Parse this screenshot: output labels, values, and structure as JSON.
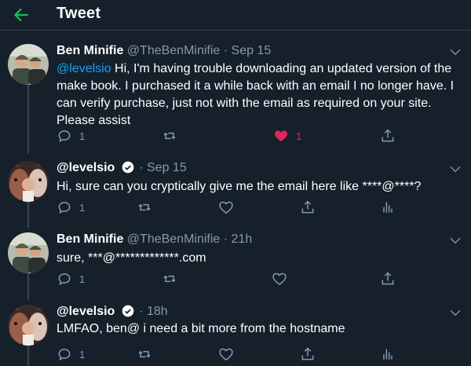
{
  "header": {
    "title": "Tweet"
  },
  "tweets": [
    {
      "name": "Ben Minifie",
      "handle": "@TheBenMinifie",
      "separator": "·",
      "time": "Sep 15",
      "mention": "@levelsio",
      "text": " Hi, I'm having trouble downloading an updated version of the make book. I purchased it a while back with an email I no longer have. I can verify purchase, just not with the email as required on your site. Please assist",
      "reply_count": "1",
      "like_count": "1"
    },
    {
      "name": "@levelsio",
      "separator": "·",
      "time": "Sep 15",
      "text": "Hi, sure can you cryptically give me the email here like ****@****?",
      "reply_count": "1"
    },
    {
      "name": "Ben Minifie",
      "handle": "@TheBenMinifie",
      "separator": "·",
      "time": "21h",
      "text": "sure, ***@*************.com",
      "reply_count": "1"
    },
    {
      "name": "@levelsio",
      "separator": "·",
      "time": "18h",
      "text": "LMFAO, ben@ i need a bit more from the hostname",
      "reply_count": "1"
    }
  ],
  "colors": {
    "background": "#15202b",
    "accent": "#1da1f2",
    "back_arrow": "#17bf63",
    "muted": "#8899a6",
    "like": "#e0245e"
  },
  "icons": {
    "back": "arrow-left-icon",
    "more": "chevron-down-icon",
    "reply": "reply-icon",
    "retweet": "retweet-icon",
    "like": "heart-icon",
    "share": "share-icon",
    "analytics": "analytics-icon",
    "verified": "verified-badge-icon"
  }
}
